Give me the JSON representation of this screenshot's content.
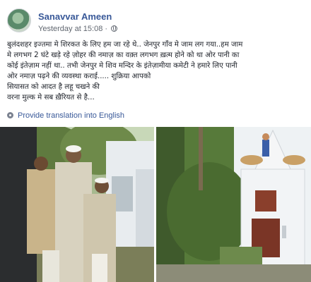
{
  "post": {
    "author": "Sanavvar Ameen",
    "timestamp": "Yesterday at 15:08",
    "separator": "·",
    "menu_icon": "ellipsis-icon",
    "privacy_icon": "globe-icon",
    "text_lines": [
      "बुलंदशहर इज्तमा मे शिरकत के लिए हम जा रहे थे.. जेनपुर गाँव मे जाम लग गया..हम जाम",
      "मे लगभग 2 घंटे खड़े रहे ज़ोहर की नमाज़ का वक़्त लगभग ख़त्म होने को था ओर पानी का",
      "कोई इंतेज़ाम नहीं था.. तभी जेनपुर मे शिव मन्दिर के इंतेज़ामीया कमेटी ने हमारे लिए पानी",
      "ओर नमाज़ पढ़ने की व्यवस्था कराई..... शुक्रिया आपको",
      "सियासत को आदत है लहू चखने की",
      "वरना मुल्क मे सब ख़ैरियत से है..."
    ],
    "translate_label": "Provide translation into English",
    "translate_icon": "translate-gear-icon"
  },
  "photos": [
    {
      "name": "men-praying-photo"
    },
    {
      "name": "temple-photo"
    }
  ],
  "colors": {
    "link": "#385898",
    "meta": "#616770",
    "text": "#1d2129"
  }
}
